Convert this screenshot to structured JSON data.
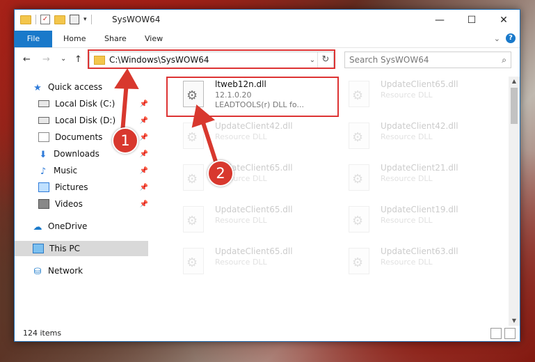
{
  "window": {
    "title": "SysWOW64",
    "controls": {
      "minimize": "—",
      "maximize": "☐",
      "close": "✕"
    }
  },
  "ribbon": {
    "tabs": [
      "File",
      "Home",
      "Share",
      "View"
    ],
    "expand_icon": "chevron-down-icon",
    "help": "?"
  },
  "nav": {
    "back": "←",
    "forward": "→",
    "recent": "⌄",
    "up": "↑",
    "address": "C:\\Windows\\SysWOW64",
    "search_placeholder": "Search SysWOW64"
  },
  "sidebar": {
    "items": [
      {
        "label": "Quick access",
        "icon": "star-icon",
        "pinned": false
      },
      {
        "label": "Local Disk (C:)",
        "icon": "drive-icon",
        "pinned": true
      },
      {
        "label": "Local Disk (D:)",
        "icon": "drive-icon",
        "pinned": true
      },
      {
        "label": "Documents",
        "icon": "documents-icon",
        "pinned": true
      },
      {
        "label": "Downloads",
        "icon": "downloads-icon",
        "pinned": true
      },
      {
        "label": "Music",
        "icon": "music-icon",
        "pinned": true
      },
      {
        "label": "Pictures",
        "icon": "pictures-icon",
        "pinned": true
      },
      {
        "label": "Videos",
        "icon": "videos-icon",
        "pinned": true
      },
      {
        "label": "OneDrive",
        "icon": "onedrive-icon",
        "pinned": false
      },
      {
        "label": "This PC",
        "icon": "this-pc-icon",
        "pinned": false,
        "selected": true
      },
      {
        "label": "Network",
        "icon": "network-icon",
        "pinned": false
      }
    ]
  },
  "files": [
    {
      "name": "ltweb12n.dll",
      "version": "12.1.0.20",
      "desc": "LEADTOOLS(r) DLL fo...",
      "faded": false
    },
    {
      "name": "UpdateClient65.dll",
      "version": "",
      "desc": "Resource DLL",
      "faded": true
    },
    {
      "name": "UpdateClient42.dll",
      "version": "",
      "desc": "Resource DLL",
      "faded": true
    },
    {
      "name": "UpdateClient42.dll",
      "version": "",
      "desc": "Resource DLL",
      "faded": true
    },
    {
      "name": "UpdateClient65.dll",
      "version": "",
      "desc": "Resource DLL",
      "faded": true
    },
    {
      "name": "UpdateClient21.dll",
      "version": "",
      "desc": "Resource DLL",
      "faded": true
    },
    {
      "name": "UpdateClient65.dll",
      "version": "",
      "desc": "Resource DLL",
      "faded": true
    },
    {
      "name": "UpdateClient19.dll",
      "version": "",
      "desc": "Resource DLL",
      "faded": true
    },
    {
      "name": "UpdateClient65.dll",
      "version": "",
      "desc": "Resource DLL",
      "faded": true
    },
    {
      "name": "UpdateClient63.dll",
      "version": "",
      "desc": "Resource DLL",
      "faded": true
    }
  ],
  "status": {
    "count": "124 items"
  },
  "callouts": [
    "1",
    "2"
  ],
  "colors": {
    "accent": "#1979ca",
    "highlight": "#dd3333",
    "callout": "#d8382e"
  }
}
